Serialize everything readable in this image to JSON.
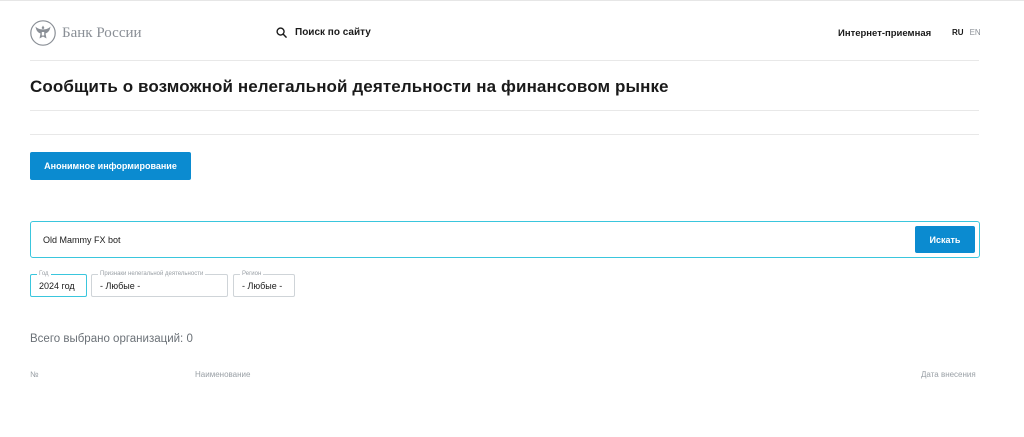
{
  "header": {
    "logo_text": "Банк России",
    "search_label": "Поиск по сайту",
    "reception_label": "Интернет-приемная",
    "lang_ru": "RU",
    "lang_en": "EN"
  },
  "page": {
    "title": "Сообщить о возможной нелегальной деятельности на финансовом рынке"
  },
  "anon_button": {
    "label": "Анонимное информирование"
  },
  "search": {
    "value": "Old Mammy FX bot",
    "button_label": "Искать"
  },
  "filters": [
    {
      "label": "Год",
      "value": "2024 год"
    },
    {
      "label": "Признаки нелегальной деятельности",
      "value": "- Любые -"
    },
    {
      "label": "Регион",
      "value": "- Любые -"
    }
  ],
  "results": {
    "total_text": "Всего выбрано организаций: 0"
  },
  "table": {
    "columns": [
      "№",
      "Наименование",
      "Дата внесения"
    ]
  },
  "colors": {
    "accent": "#0b8bd0",
    "focus_border": "#3ac6dd"
  },
  "icons": {
    "logo": "bank-eagle-emblem-icon",
    "search": "search-icon"
  }
}
